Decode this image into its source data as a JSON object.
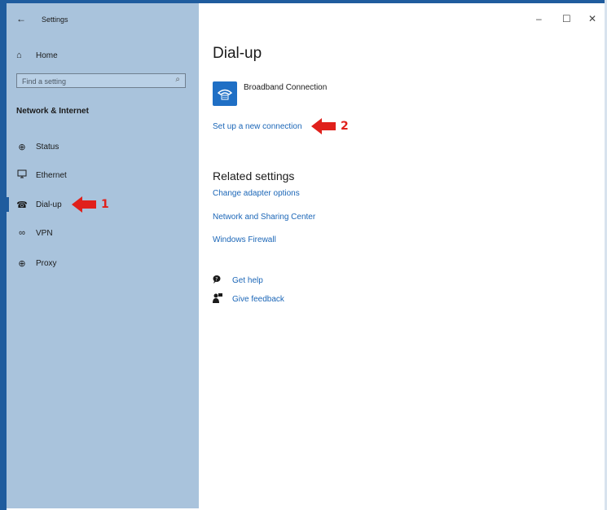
{
  "window": {
    "title": "Settings",
    "controls": {
      "minimize": "–",
      "maximize": "☐",
      "close": "✕"
    }
  },
  "sidebar": {
    "back_glyph": "←",
    "home": {
      "label": "Home",
      "icon": "home-icon"
    },
    "search": {
      "placeholder": "Find a setting",
      "icon": "search-icon"
    },
    "section_heading": "Network & Internet",
    "items": [
      {
        "label": "Status",
        "icon": "globe-icon",
        "active": false
      },
      {
        "label": "Ethernet",
        "icon": "monitor-icon",
        "active": false
      },
      {
        "label": "Dial-up",
        "icon": "dialup-phone-icon",
        "active": true
      },
      {
        "label": "VPN",
        "icon": "vpn-icon",
        "active": false
      },
      {
        "label": "Proxy",
        "icon": "globe-icon",
        "active": false
      }
    ],
    "colors": {
      "background": "#a9c3dc",
      "accent": "#1f5c9e"
    }
  },
  "annotations": {
    "arrow1_number": "1",
    "arrow2_number": "2",
    "color": "#e0201b"
  },
  "main": {
    "title": "Dial-up",
    "connection": {
      "name": "Broadband Connection",
      "icon": "dialup-phone-icon",
      "tile_color": "#1f6fc5"
    },
    "setup_link": "Set up a new connection",
    "related": {
      "heading": "Related settings",
      "links": [
        "Change adapter options",
        "Network and Sharing Center",
        "Windows Firewall"
      ]
    },
    "help": [
      {
        "label": "Get help",
        "icon": "help-chat-icon"
      },
      {
        "label": "Give feedback",
        "icon": "feedback-person-icon"
      }
    ],
    "link_color": "#1b66b7"
  }
}
